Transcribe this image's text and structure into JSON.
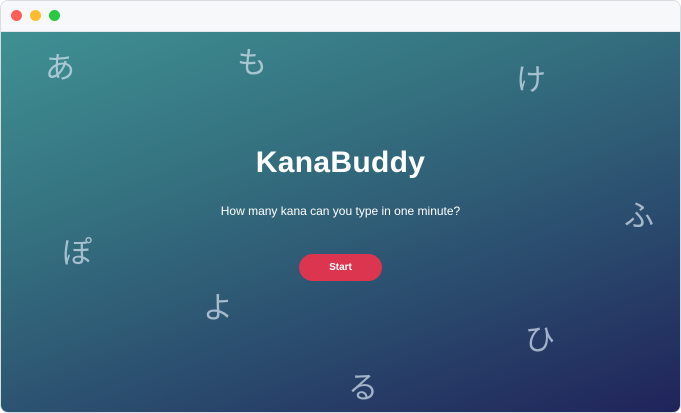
{
  "app": {
    "title": "KanaBuddy",
    "subtitle": "How many kana can you type in one minute?",
    "start_label": "Start"
  },
  "window": {
    "controls": [
      "close-icon",
      "minimize-icon",
      "maximize-icon"
    ]
  },
  "background_kana": [
    "あ",
    "も",
    "け",
    "ふ",
    "ぽ",
    "よ",
    "ひ",
    "る"
  ],
  "colors": {
    "gradient_start": "#3f9093",
    "gradient_end": "#20235a",
    "button": "#dc354f",
    "text": "#ffffff"
  }
}
